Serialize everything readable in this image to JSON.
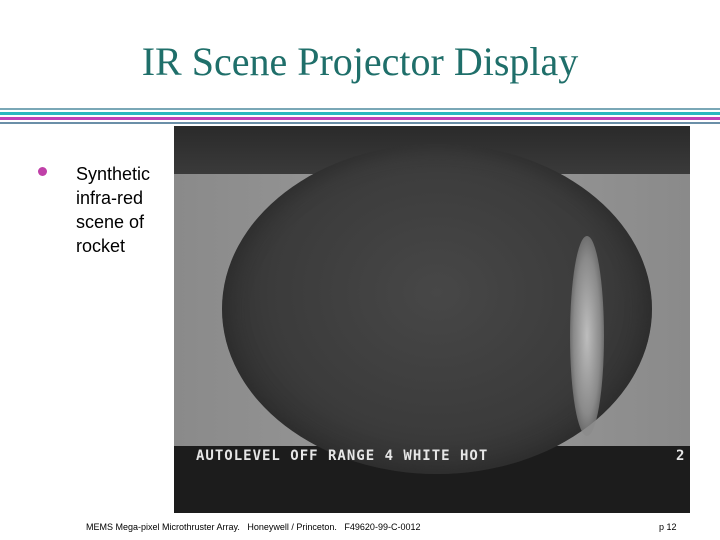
{
  "slide": {
    "title": "IR Scene Projector Display",
    "bullet": "Synthetic infra-red scene of rocket"
  },
  "image": {
    "status_text": "AUTOLEVEL OFF RANGE 4 WHITE HOT",
    "status_right": "2"
  },
  "footer": {
    "citation": "MEMS Mega-pixel Microthruster Array.   Honeywell / Princeton.   F49620-99-C-0012",
    "page": "p 12"
  },
  "colors": {
    "title": "#1f6f6a",
    "bullet": "#c040a8",
    "rule_cyan": "#2bb8c0",
    "rule_magenta": "#c042b8"
  }
}
